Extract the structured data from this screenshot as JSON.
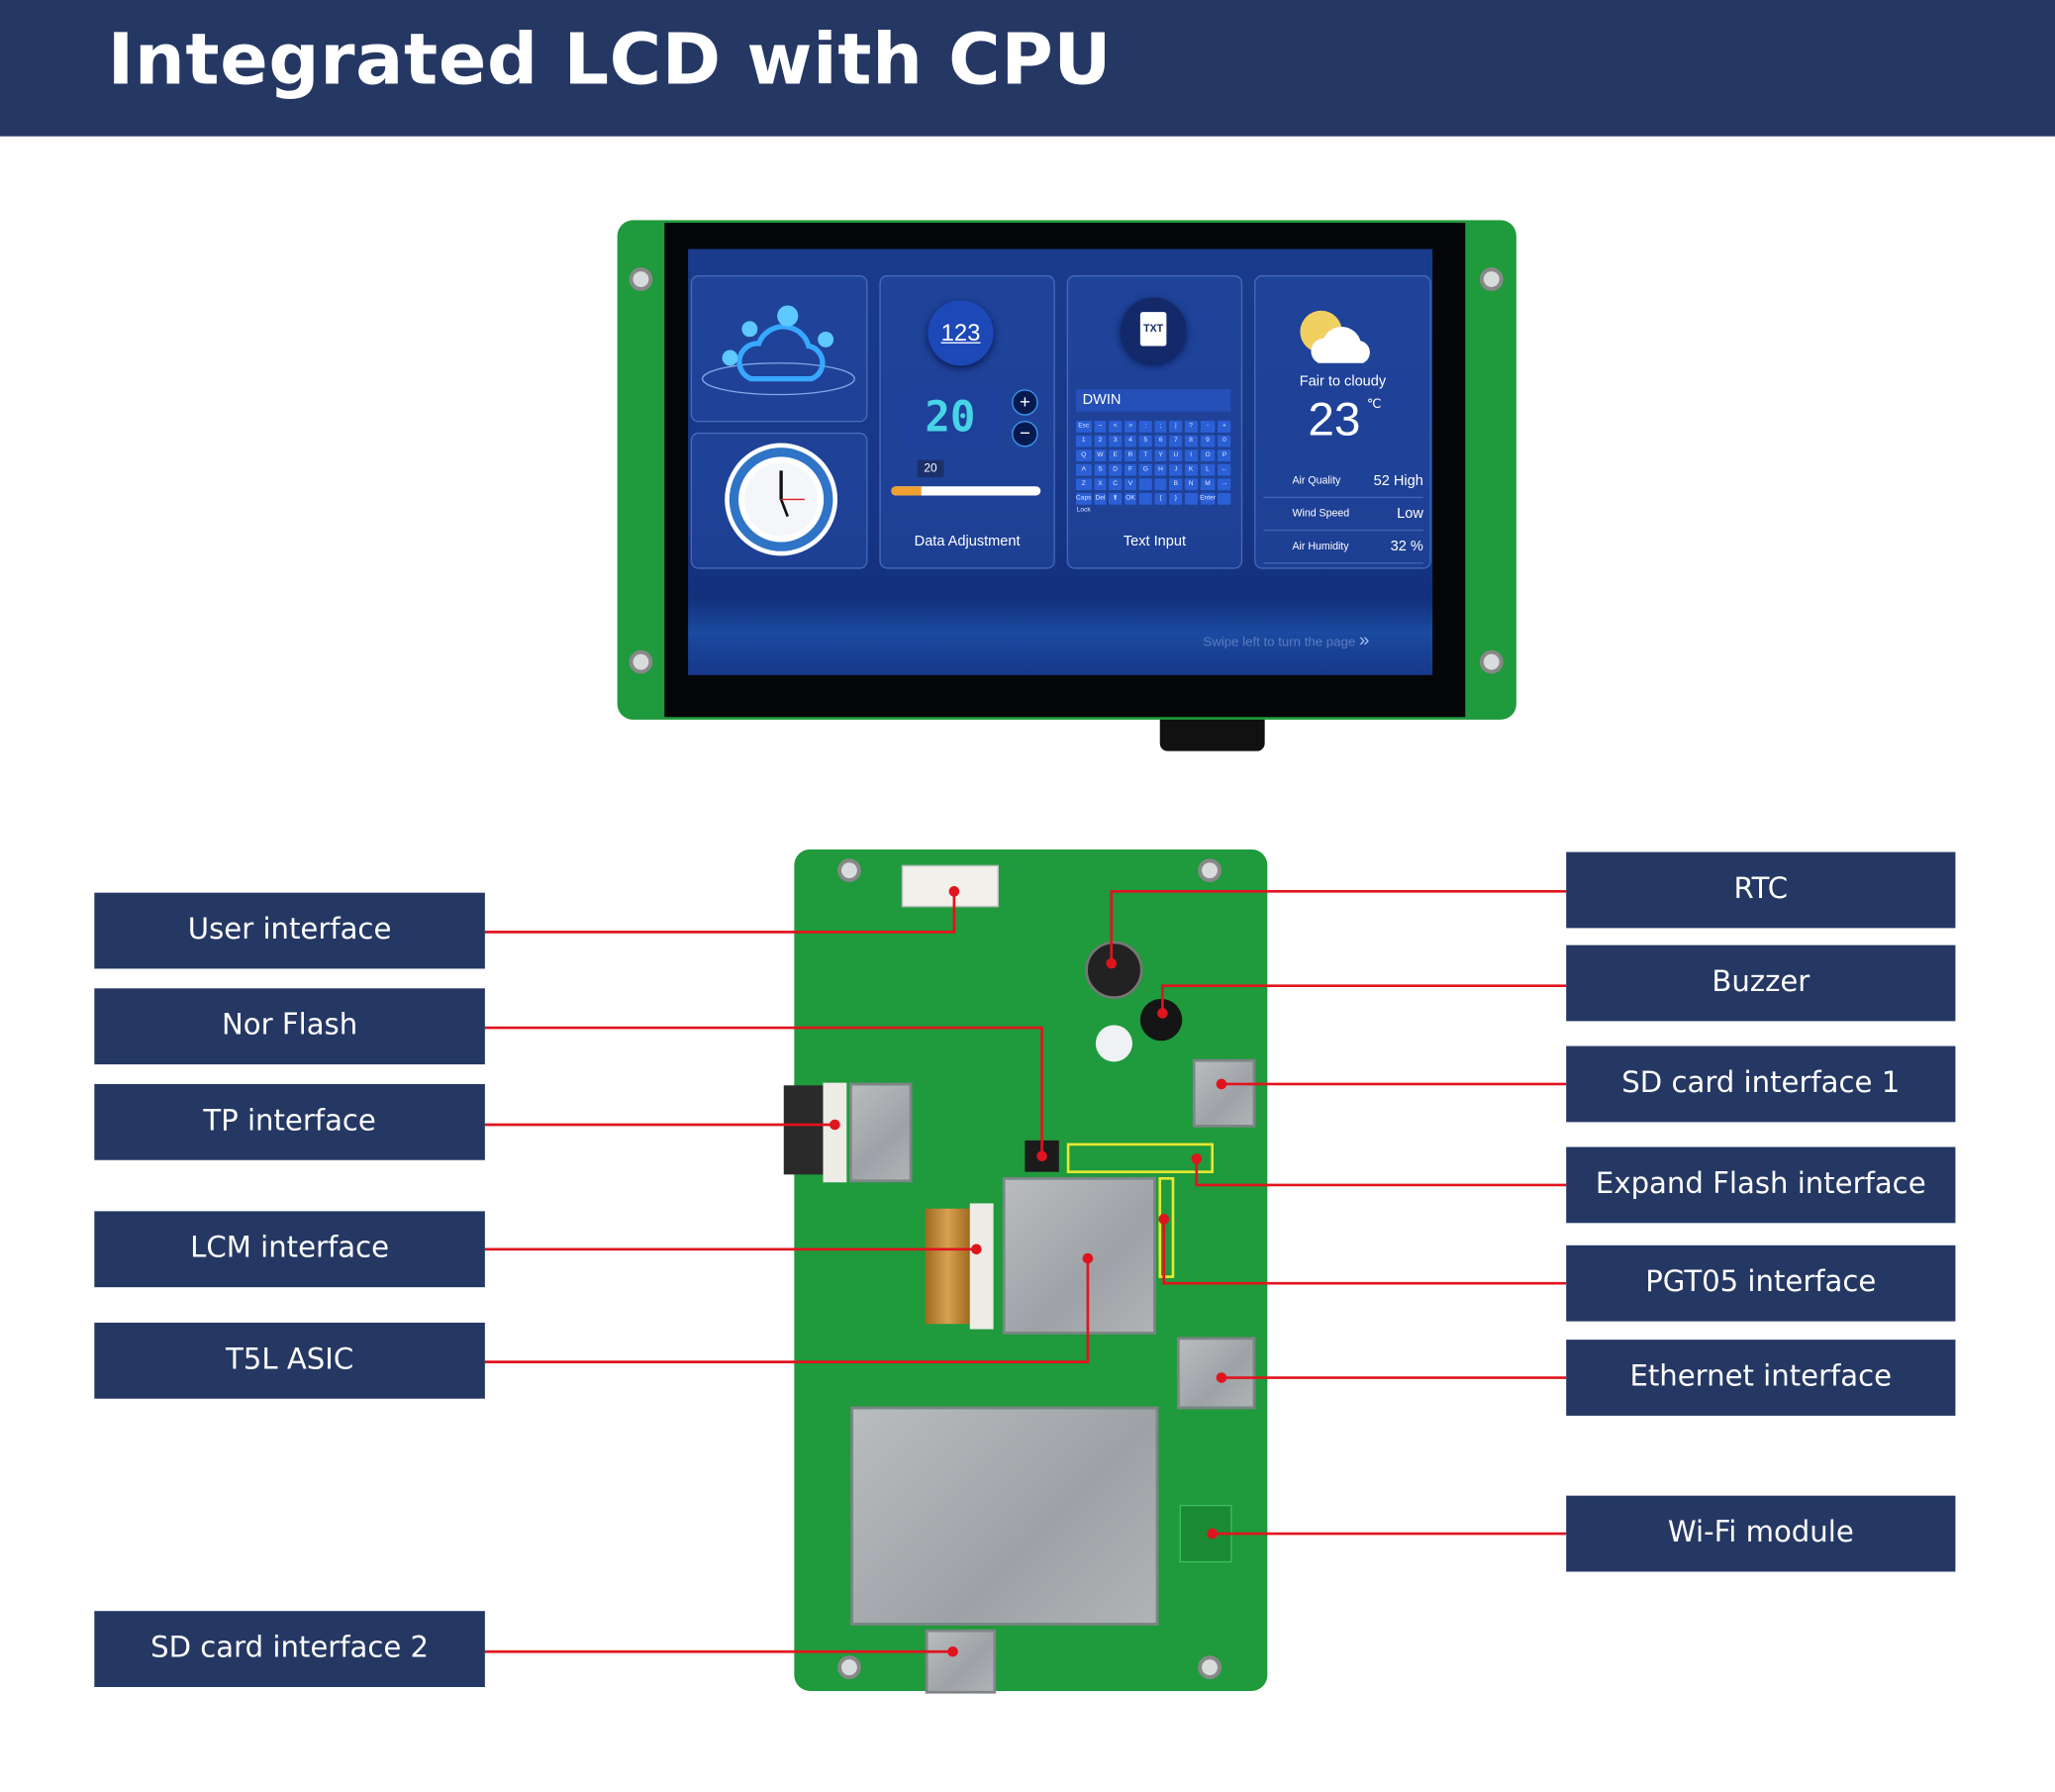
{
  "header": {
    "title": "Integrated LCD with CPU"
  },
  "screen": {
    "data_adjustment": {
      "icon_text": "123",
      "value": "20",
      "slider_value": "20",
      "slider_fraction": 0.2,
      "label": "Data Adjustment"
    },
    "text_input": {
      "icon_text": "TXT",
      "field_value": "DWIN",
      "label": "Text Input",
      "keys": [
        "Esc",
        "~",
        "<",
        ">",
        ":",
        ";",
        "|",
        "?",
        "-",
        "+",
        "1",
        "2",
        "3",
        "4",
        "5",
        "6",
        "7",
        "8",
        "9",
        "0",
        "Q",
        "W",
        "E",
        "R",
        "T",
        "Y",
        "U",
        "I",
        "O",
        "P",
        "A",
        "S",
        "D",
        "F",
        "G",
        "H",
        "J",
        "K",
        "L",
        "←",
        "Z",
        "X",
        "C",
        "V",
        "",
        "",
        "B",
        "N",
        "M",
        "→",
        "Caps Lock",
        "Del",
        "⬆",
        "OK",
        "",
        "{",
        "}",
        "",
        "Enter",
        ""
      ]
    },
    "weather": {
      "condition": "Fair to cloudy",
      "temperature": "23",
      "unit": "℃",
      "rows": [
        {
          "label": "Air Quality",
          "value": "52 High"
        },
        {
          "label": "Wind Speed",
          "value": "Low"
        },
        {
          "label": "Air Humidity",
          "value": "32 %"
        }
      ]
    },
    "swipe_hint": "Swipe left to turn the page"
  },
  "callouts": {
    "left": [
      "User interface",
      "Nor Flash",
      "TP interface",
      "LCM interface",
      "T5L ASIC",
      "SD card interface 2"
    ],
    "right": [
      "RTC",
      "Buzzer",
      "SD card interface 1",
      "Expand Flash interface",
      "PGT05 interface",
      "Ethernet interface",
      "Wi-Fi module"
    ]
  },
  "colors": {
    "header": "#253864",
    "label_bg": "#253864",
    "pcb": "#1f9a3c",
    "leader": "#e0141e",
    "flash_outline": "#e8e830"
  }
}
